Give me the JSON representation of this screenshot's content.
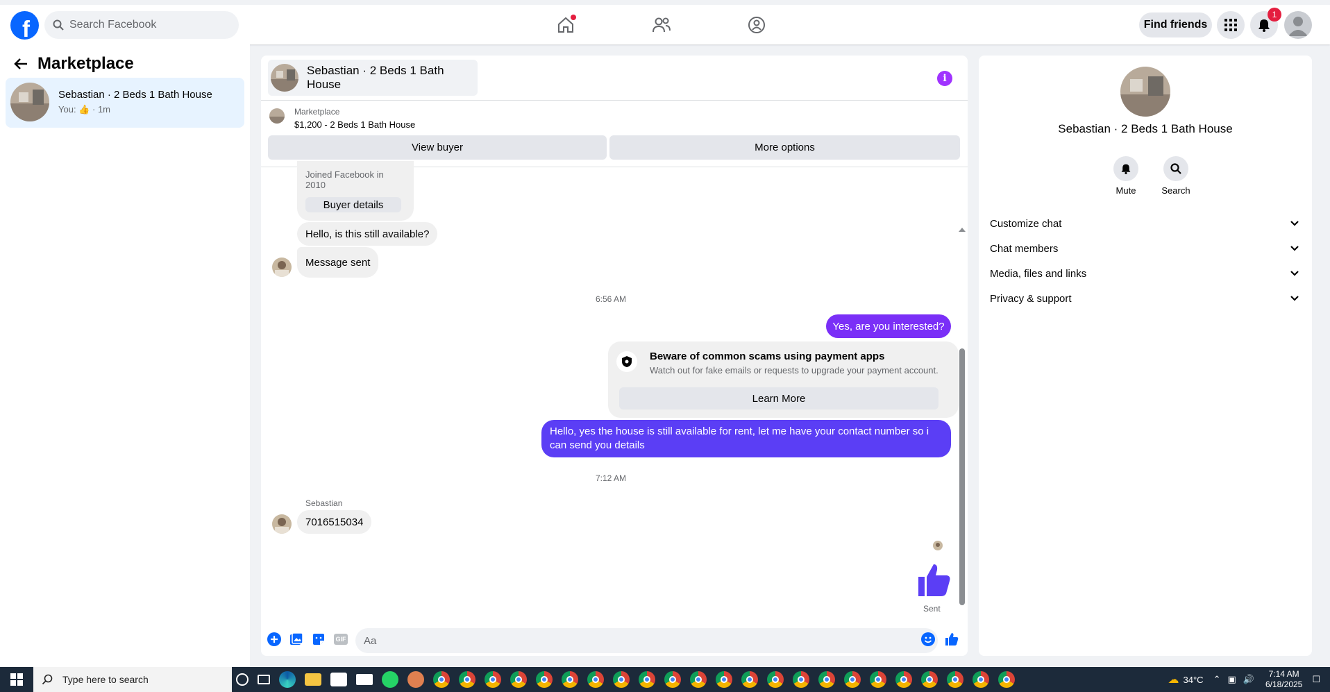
{
  "topbar": {
    "search_placeholder": "Search Facebook",
    "find_friends": "Find friends",
    "notification_count": "1"
  },
  "left": {
    "title": "Marketplace",
    "conversation": {
      "title": "Sebastian · 2 Beds 1 Bath House",
      "you_label": "You:",
      "time": "· 1m"
    }
  },
  "chat": {
    "header_title": "Sebastian · 2 Beds 1 Bath House",
    "marketplace_label": "Marketplace",
    "listing": "$1,200 - 2 Beds 1 Bath House",
    "view_buyer": "View buyer",
    "more_options": "More options",
    "joined": "Joined Facebook in 2010",
    "buyer_details": "Buyer details",
    "msg_available": "Hello, is this still available?",
    "msg_sent_notice": "Message sent",
    "time1": "6:56 AM",
    "reply1": "Yes, are you interested?",
    "scam_title": "Beware of common scams using payment apps",
    "scam_desc": "Watch out for fake emails or requests to upgrade your payment account.",
    "learn_more": "Learn More",
    "reply2": "Hello, yes the house is still available for rent, let me have your contact number so i can send you details",
    "time2": "7:12 AM",
    "sender_name": "Sebastian",
    "phone_msg": "7016515034",
    "sent_status": "Sent",
    "composer_placeholder": "Aa",
    "gif_label": "GIF"
  },
  "right": {
    "name": "Sebastian · 2 Beds 1 Bath House",
    "mute": "Mute",
    "search": "Search",
    "sections": [
      "Customize chat",
      "Chat members",
      "Media, files and links",
      "Privacy & support"
    ]
  },
  "taskbar": {
    "search_placeholder": "Type here to search",
    "temperature": "34°C",
    "time": "7:14 AM",
    "date": "6/18/2025"
  },
  "colors": {
    "brand": "#0866ff",
    "outgoing_bubble": "#7a2ff7",
    "info": "#a033ff",
    "selected_conv": "#e7f3ff"
  }
}
